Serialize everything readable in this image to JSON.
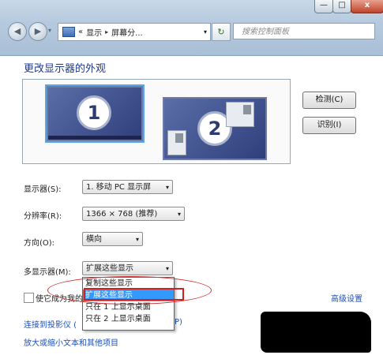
{
  "window": {
    "minimize_icon": "minimize-icon",
    "maximize_icon": "maximize-icon",
    "close_icon": "close-icon",
    "minimize_glyph": "—",
    "maximize_glyph": "□",
    "close_glyph": "x"
  },
  "nav": {
    "back_glyph": "◀",
    "forward_glyph": "▶",
    "history_glyph": "▾",
    "refresh_glyph": "↻"
  },
  "address": {
    "prefix": "«",
    "crumbs": [
      "显示",
      "屏幕分..."
    ],
    "separator": "▸",
    "dropdown_glyph": "▾"
  },
  "search": {
    "placeholder": "搜索控制面板"
  },
  "main": {
    "title": "更改显示器的外观",
    "monitor1_number": "1",
    "monitor2_number": "2",
    "detect_button": "检测(C)",
    "identify_button": "识别(I)"
  },
  "settings": {
    "display": {
      "label": "显示器(S):",
      "value": "1. 移动 PC 显示屏"
    },
    "resolution": {
      "label": "分辨率(R):",
      "value": "1366 × 768 (推荐)"
    },
    "orientation": {
      "label": "方向(O):",
      "value": "横向"
    },
    "multiple_displays": {
      "label": "多显示器(M):",
      "value": "扩展这些显示",
      "options": [
        "复制这些显示",
        "扩展这些显示",
        "只在 1 上显示桌面",
        "只在 2 上显示桌面"
      ],
      "selected_index": 1
    },
    "dropdown_arrow": "▾"
  },
  "checkbox": {
    "label": "使它成为我的",
    "checked": false
  },
  "links": {
    "projector": "连接到投影仪 (",
    "projector_tail": "P)",
    "text_size": "放大或缩小文本和其他项目",
    "advanced": "高级设置"
  },
  "colors": {
    "accent": "#1d4fb8",
    "highlight": "#3399ff",
    "annotation": "#d02020"
  }
}
